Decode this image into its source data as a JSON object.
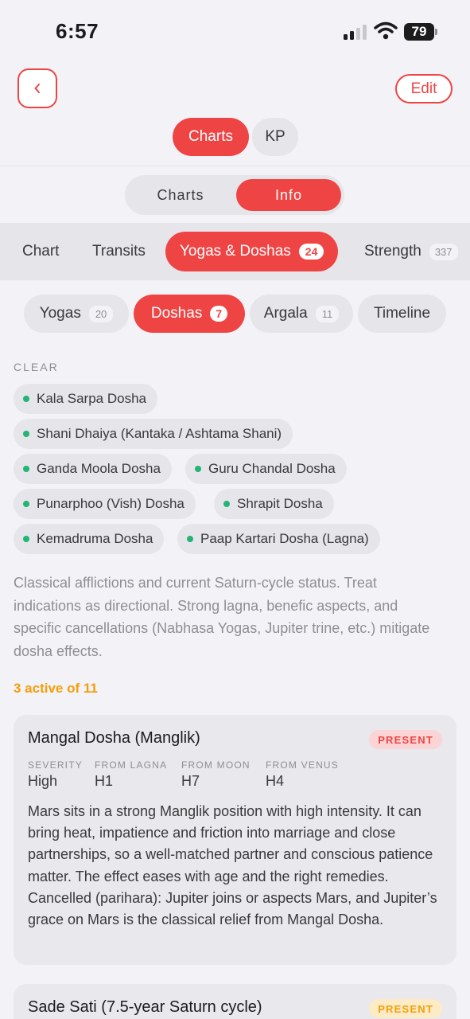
{
  "status_bar": {
    "time": "6:57",
    "battery": "79"
  },
  "header": {
    "edit_label": "Edit"
  },
  "mode_tabs": [
    {
      "label": "Charts"
    },
    {
      "label": "KP"
    }
  ],
  "view_tabs": [
    {
      "label": "Charts"
    },
    {
      "label": "Info"
    }
  ],
  "main_tabs": [
    {
      "label": "Chart"
    },
    {
      "label": "Transits"
    },
    {
      "label": "Yogas & Doshas",
      "count": "24"
    },
    {
      "label": "Strength",
      "count": "337"
    }
  ],
  "sub_tabs": [
    {
      "label": "Yogas",
      "count": "20"
    },
    {
      "label": "Doshas",
      "count": "7"
    },
    {
      "label": "Argala",
      "count": "11"
    },
    {
      "label": "Timeline"
    }
  ],
  "clear_section": {
    "title": "CLEAR",
    "items": [
      "Kala Sarpa Dosha",
      "Shani Dhaiya (Kantaka / Ashtama Shani)",
      "Ganda Moola Dosha",
      "Guru Chandal Dosha",
      "Punarphoo (Vish) Dosha",
      "Shrapit Dosha",
      "Kemadruma Dosha",
      "Paap Kartari Dosha (Lagna)"
    ]
  },
  "description": "Classical afflictions and current Saturn-cycle status. Treat indications as directional. Strong lagna, benefic aspects, and specific cancellations (Nabhasa Yogas, Jupiter trine, etc.) mitigate dosha effects.",
  "active_count": "3 active of 11",
  "doshas": [
    {
      "title": "Mangal Dosha (Manglik)",
      "status": "PRESENT",
      "columns": [
        {
          "label": "SEVERITY",
          "value": "High"
        },
        {
          "label": "FROM LAGNA",
          "value": "H1"
        },
        {
          "label": "FROM MOON",
          "value": "H7"
        },
        {
          "label": "FROM VENUS",
          "value": "H4"
        }
      ],
      "body": "Mars sits in a strong Manglik position with high intensity. It can bring heat, impatience and friction into marriage and close partnerships, so a well-matched partner and conscious patience matter. The effect eases with age and the right remedies. Cancelled (parihara): Jupiter joins or aspects Mars, and Jupiter’s grace on Mars is the classical relief from Mangal Dosha."
    },
    {
      "title": "Sade Sati (7.5-year Saturn cycle)",
      "status": "PRESENT"
    }
  ],
  "colors": {
    "accent": "#ef4444",
    "clear_dot": "#22b573",
    "amber": "#f59e0b"
  },
  "icons": {
    "back": "chevron-left-icon"
  }
}
